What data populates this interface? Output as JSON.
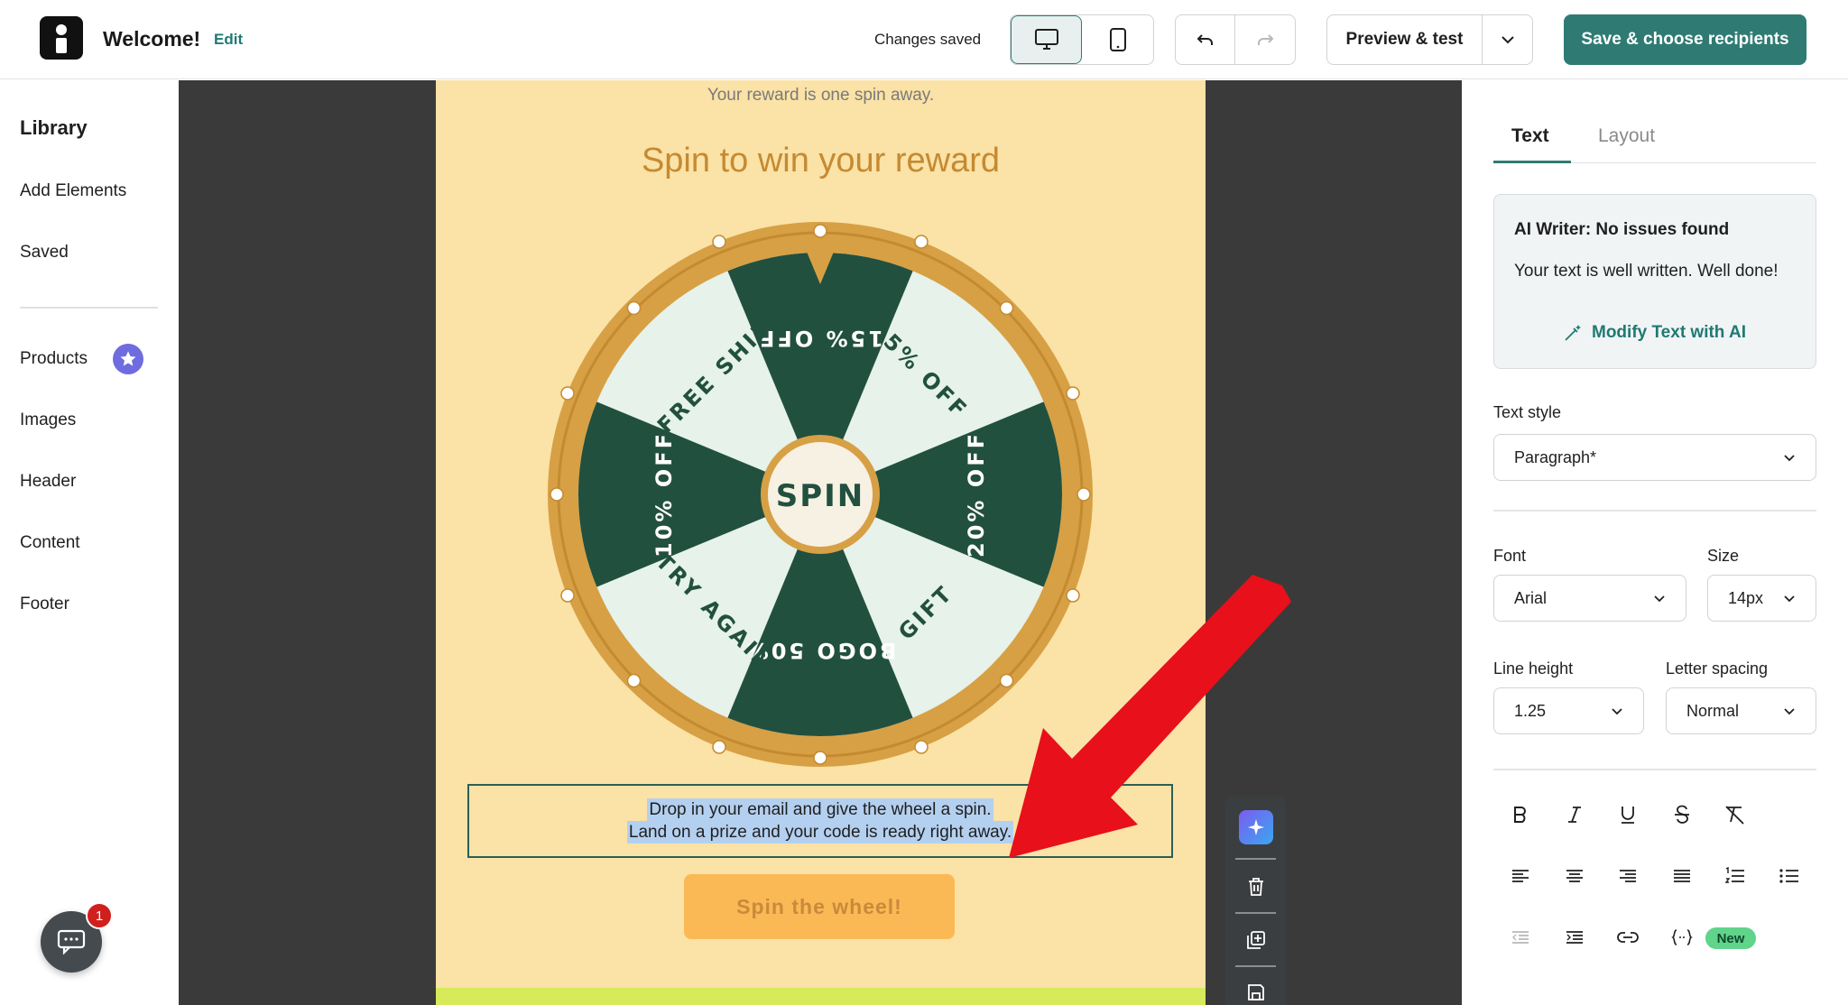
{
  "header": {
    "title": "Welcome!",
    "edit_label": "Edit",
    "status": "Changes saved",
    "preview_label": "Preview & test",
    "save_label": "Save & choose recipients"
  },
  "library": {
    "title": "Library",
    "items": [
      "Add Elements",
      "Saved",
      "Products",
      "Images",
      "Header",
      "Content",
      "Footer"
    ],
    "chat_badge_count": "1"
  },
  "email": {
    "reward_line": "Your reward is one spin away.",
    "heading": "Spin to win your reward",
    "wheel": {
      "center_label": "SPIN",
      "segments": [
        "15% OFF",
        "5% OFF",
        "20% OFF",
        "GIFT",
        "BOGO 50%",
        "TRY AGAIN",
        "10% OFF",
        "FREE SHIP"
      ]
    },
    "body_line1": "Drop in your email and give the wheel a spin.",
    "body_line2": "Land on a prize and your code is ready right away.",
    "cta_label": "Spin the wheel!"
  },
  "panel": {
    "tabs": [
      "Text",
      "Layout"
    ],
    "ai_title": "AI Writer: No issues found",
    "ai_message": "Your text is well written. Well done!",
    "ai_link": "Modify Text with AI",
    "text_style_label": "Text style",
    "text_style_value": "Paragraph*",
    "font_label": "Font",
    "font_value": "Arial",
    "size_label": "Size",
    "size_value": "14px",
    "line_height_label": "Line height",
    "line_height_value": "1.25",
    "letter_spacing_label": "Letter spacing",
    "letter_spacing_value": "Normal",
    "new_badge": "New"
  },
  "colors": {
    "accent": "#2f7b73",
    "email_bg": "#fbe2a6",
    "heading": "#c58a32",
    "wheel_dark": "#22503f",
    "wheel_light": "#e6f2ea",
    "wheel_rim": "#d7a045",
    "cta": "#fbb956",
    "arrow": "#e8101a"
  },
  "icons": [
    "desktop-icon",
    "mobile-icon",
    "undo-icon",
    "redo-icon",
    "chevron-down-icon",
    "star-icon",
    "chat-icon",
    "ai-sparkle-icon",
    "trash-icon",
    "duplicate-icon",
    "save-icon",
    "bold-icon",
    "italic-icon",
    "underline-icon",
    "strikethrough-icon",
    "clear-format-icon",
    "align-left-icon",
    "align-center-icon",
    "align-right-icon",
    "align-justify-icon",
    "ordered-list-icon",
    "bullet-list-icon",
    "outdent-icon",
    "indent-icon",
    "link-icon",
    "merge-tag-icon"
  ]
}
